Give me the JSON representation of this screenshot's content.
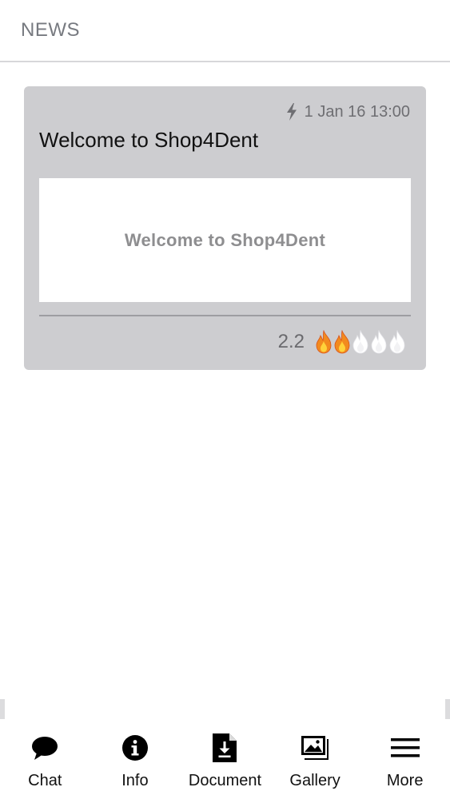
{
  "header": {
    "title": "NEWS"
  },
  "news": {
    "items": [
      {
        "date": "1 Jan 16 13:00",
        "title": "Welcome to Shop4Dent",
        "image_text": "Welcome to Shop4Dent",
        "rating": "2.2",
        "rating_fraction": 0.4
      }
    ]
  },
  "tabs": [
    {
      "label": "Chat",
      "icon": "chat-bubble-icon"
    },
    {
      "label": "Info",
      "icon": "info-icon"
    },
    {
      "label": "Document",
      "icon": "document-download-icon"
    },
    {
      "label": "Gallery",
      "icon": "gallery-image-icon"
    },
    {
      "label": "More",
      "icon": "hamburger-menu-icon"
    }
  ],
  "colors": {
    "card_bg": "#cdcdd0",
    "flame_active": "#f28a1e",
    "flame_inactive": "#ffffff"
  }
}
